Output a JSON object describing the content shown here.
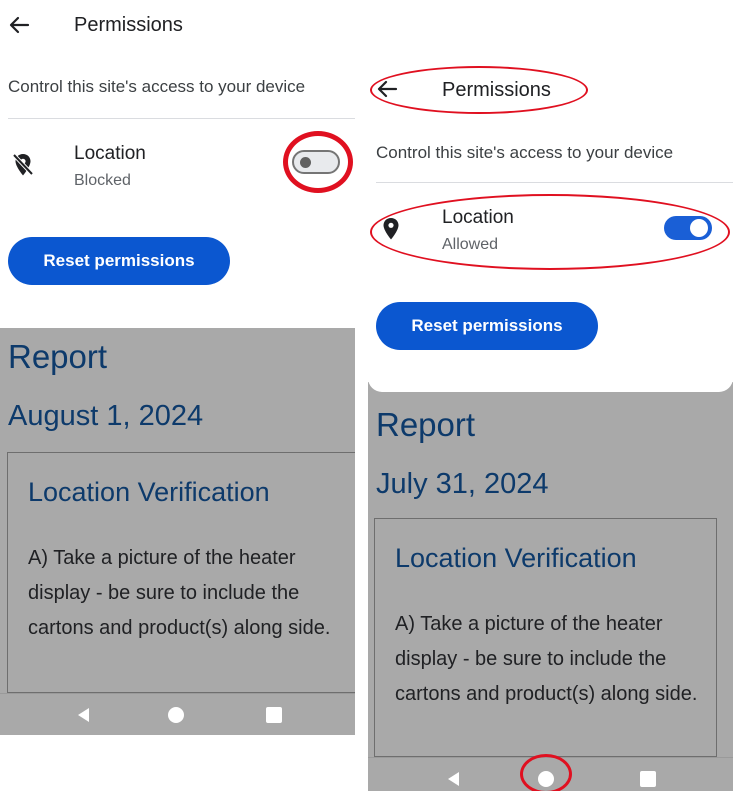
{
  "left_screen": {
    "header": {
      "title": "Permissions"
    },
    "subtitle": "Control this site's access to your device",
    "permission": {
      "name": "Location",
      "status": "Blocked",
      "enabled": false
    },
    "reset_button": "Reset permissions",
    "report": {
      "title": "Report",
      "date": "August 1, 2024",
      "card_heading": "Location Verification",
      "card_text": "A) Take a picture of the heater display - be sure to include the cartons and product(s) along side."
    }
  },
  "right_screen": {
    "header": {
      "title": "Permissions"
    },
    "subtitle": "Control this site's access to your device",
    "permission": {
      "name": "Location",
      "status": "Allowed",
      "enabled": true
    },
    "reset_button": "Reset permissions",
    "report": {
      "title": "Report",
      "date": "July 31, 2024",
      "card_heading": "Location Verification",
      "card_text": "A) Take a picture of the heater display - be sure to include the cartons and product(s) along side."
    }
  },
  "icons": {
    "back": "back-arrow-icon",
    "location_off": "location-off-icon",
    "location_on": "location-pin-icon",
    "nav_back": "nav-back-icon",
    "nav_home": "nav-home-icon",
    "nav_recents": "nav-recents-icon"
  },
  "colors": {
    "accent": "#0b57d0",
    "toggle_on": "#1a5fd6",
    "report_text": "#0d3a6b",
    "annotation": "#e01020",
    "overlay": "#a9a9a9"
  }
}
